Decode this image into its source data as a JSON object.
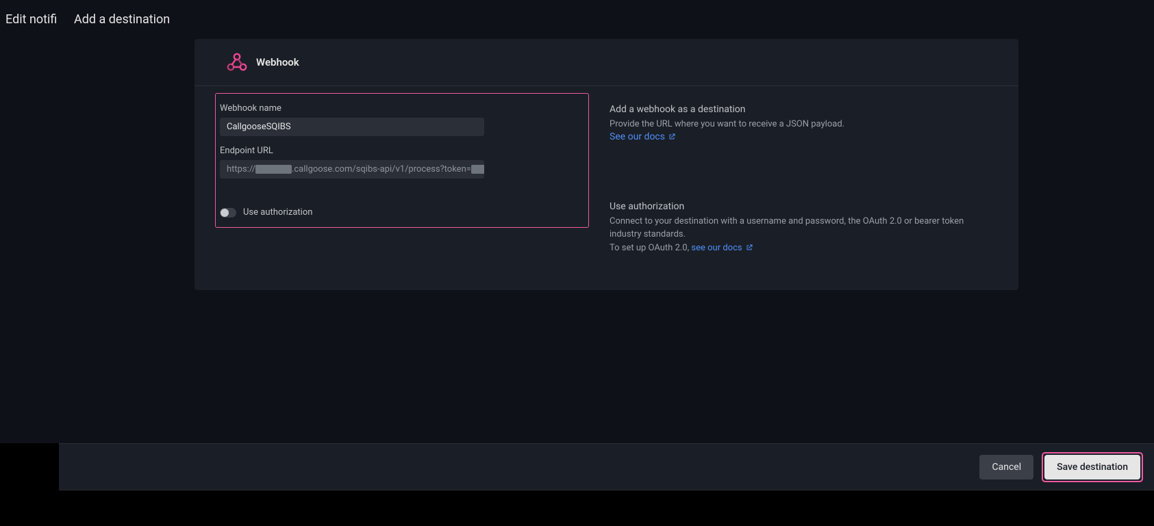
{
  "background": {
    "page_title": "Edit notifi"
  },
  "modal": {
    "title": "Add a destination",
    "panel": {
      "header": {
        "icon": "webhook-icon",
        "title": "Webhook"
      },
      "form": {
        "name_label": "Webhook name",
        "name_value": "CallgooseSQIBS",
        "url_label": "Endpoint URL",
        "url_prefix": "https://",
        "url_blur1": "_________",
        "url_mid": ".callgoose.com/sqibs-api/v1/process?token=",
        "url_blur2": "______",
        "auth_toggle_label": "Use authorization"
      },
      "help": {
        "webhook_title": "Add a webhook as a destination",
        "webhook_text": "Provide the URL where you want to receive a JSON payload.",
        "webhook_link": "See our docs",
        "auth_title": "Use authorization",
        "auth_text": "Connect to your destination with a username and password, the OAuth 2.0 or bearer token industry standards.",
        "auth_prefix": "To set up OAuth 2.0, ",
        "auth_link": "see our docs"
      }
    },
    "footer": {
      "cancel": "Cancel",
      "save": "Save destination"
    }
  }
}
